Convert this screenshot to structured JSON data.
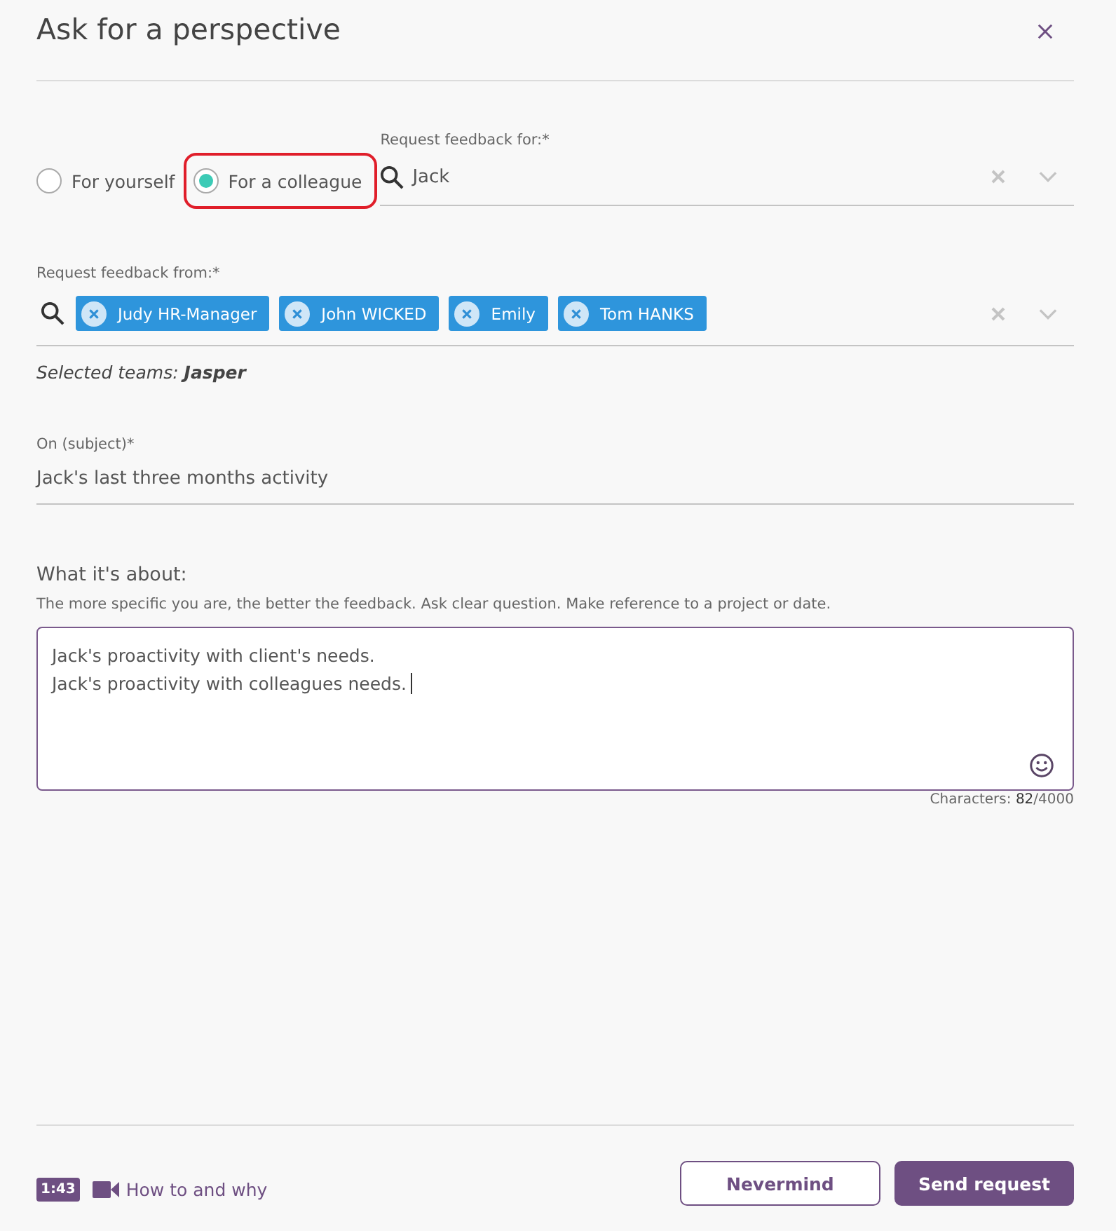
{
  "dialog": {
    "title": "Ask for a perspective"
  },
  "recipient_options": [
    {
      "label": "For yourself",
      "selected": false,
      "highlighted": false
    },
    {
      "label": "For a colleague",
      "selected": true,
      "highlighted": true
    }
  ],
  "feedback_for": {
    "label": "Request feedback for:*",
    "value": "Jack"
  },
  "feedback_from": {
    "label": "Request feedback from:*",
    "chips": [
      "Judy HR-Manager",
      "John WICKED",
      "Emily",
      "Tom HANKS"
    ]
  },
  "selected_teams": "Selected teams: **Jasper**",
  "subject": {
    "label": "On (subject)*",
    "value": "Jack's last three months activity"
  },
  "about": {
    "label": "What it's about:",
    "hint": "The more specific you are, the better the feedback. Ask clear question. Make reference to a project or date.",
    "value": "Jack's proactivity with client's needs.\nJack's proactivity with colleagues needs.",
    "char_count": "Characters: **82**/4000"
  },
  "footer": {
    "video_duration": "1:43",
    "help_link": "How to and why",
    "buttons": [
      {
        "label": "Nevermind",
        "kind": "secondary"
      },
      {
        "label": "Send request",
        "kind": "primary"
      }
    ]
  }
}
